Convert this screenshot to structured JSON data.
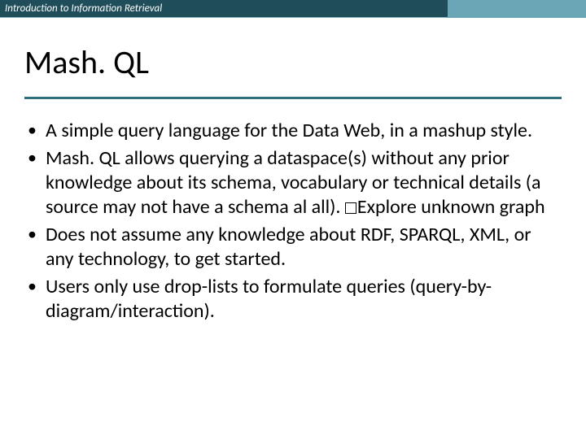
{
  "header": {
    "course": "Introduction to Information Retrieval"
  },
  "title": "Mash. QL",
  "bullets": [
    "A simple query language for the Data Web, in a mashup style.",
    "Mash. QL allows querying a dataspace(s) without any prior knowledge about its schema, vocabulary or technical details (a source may not have a schema al all). ▢Explore unknown graph",
    "Does not assume any knowledge about RDF, SPARQL, XML, or any technology, to get started.",
    "Users only use drop-lists to formulate queries (query-by-diagram/interaction)."
  ]
}
